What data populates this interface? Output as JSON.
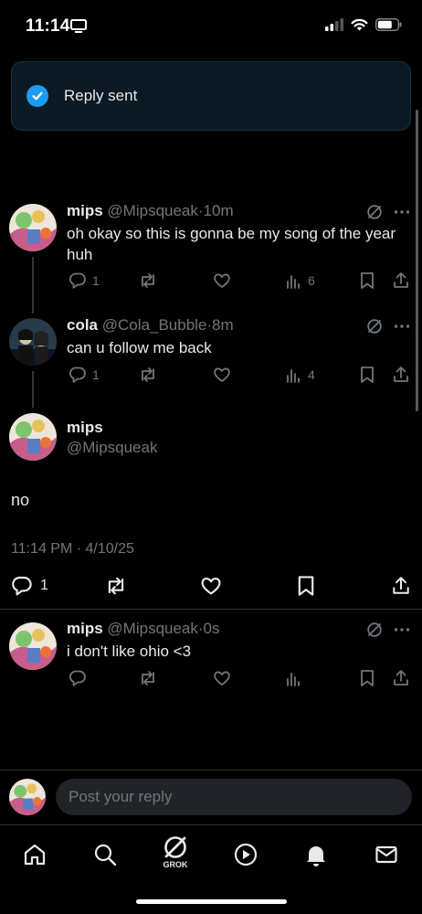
{
  "status_bar": {
    "time": "11:14"
  },
  "toast": {
    "text": "Reply sent"
  },
  "tweets": [
    {
      "name": "mips",
      "handle": "@Mipsqueak",
      "time": "·10m",
      "text": "oh okay so this is gonna be my song of the year huh",
      "replies": "1",
      "reposts": "",
      "likes": "",
      "views": "6"
    },
    {
      "name": "cola",
      "handle": "@Cola_Bubble",
      "time": "·8m",
      "text": "can u follow me back",
      "replies": "1",
      "reposts": "",
      "likes": "",
      "views": "4"
    }
  ],
  "main_tweet": {
    "name": "mips",
    "handle": "@Mipsqueak",
    "text": "no",
    "meta": "11:14 PM · 4/10/25",
    "replies": "1"
  },
  "reply_tweet": {
    "name": "mips",
    "handle": "@Mipsqueak",
    "time": "·0s",
    "text": "i don't like ohio <3"
  },
  "reply_box": {
    "placeholder": "Post your reply"
  },
  "tab_bar": {
    "grok_label": "GROK"
  },
  "colors": {
    "accent": "#1d9bf0",
    "muted": "#71767b",
    "background": "#000000"
  },
  "icons": [
    "screen-mirror-icon",
    "signal-icon",
    "wifi-icon",
    "battery-icon",
    "check-icon",
    "grok-icon",
    "more-icon",
    "reply-icon",
    "repost-icon",
    "like-icon",
    "views-icon",
    "bookmark-icon",
    "share-icon",
    "home-icon",
    "search-icon",
    "play-icon",
    "bell-icon",
    "mail-icon"
  ]
}
